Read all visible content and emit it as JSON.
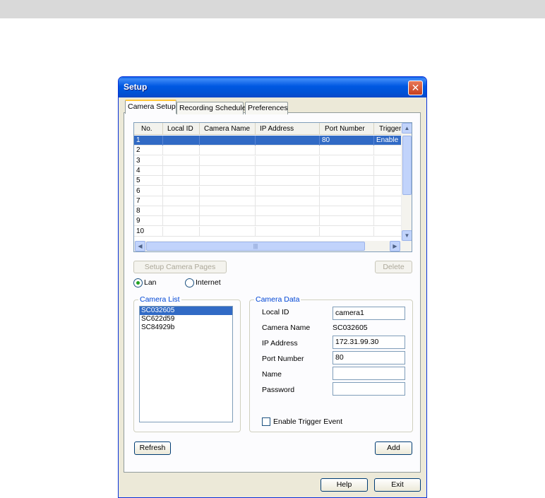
{
  "window": {
    "title": "Setup",
    "close_glyph": "✕"
  },
  "tabs": [
    "Camera Setup",
    "Recording Schedule",
    "Preferences"
  ],
  "grid": {
    "columns": [
      "No.",
      "Local ID",
      "Camera Name",
      "IP Address",
      "Port Number",
      "Trigger"
    ],
    "rows": [
      [
        "1",
        "",
        "",
        "",
        "80",
        "Enable"
      ],
      [
        "2",
        "",
        "",
        "",
        "",
        ""
      ],
      [
        "3",
        "",
        "",
        "",
        "",
        ""
      ],
      [
        "4",
        "",
        "",
        "",
        "",
        ""
      ],
      [
        "5",
        "",
        "",
        "",
        "",
        ""
      ],
      [
        "6",
        "",
        "",
        "",
        "",
        ""
      ],
      [
        "7",
        "",
        "",
        "",
        "",
        ""
      ],
      [
        "8",
        "",
        "",
        "",
        "",
        ""
      ],
      [
        "9",
        "",
        "",
        "",
        "",
        ""
      ],
      [
        "10",
        "",
        "",
        "",
        "",
        ""
      ]
    ],
    "selected_row": 0
  },
  "buttons": {
    "setup_camera_pages": "Setup Camera Pages",
    "delete": "Delete",
    "refresh": "Refresh",
    "add": "Add",
    "help": "Help",
    "exit": "Exit"
  },
  "network": {
    "lan": "Lan",
    "internet": "Internet",
    "selected": "Lan"
  },
  "camera_list": {
    "title": "Camera List",
    "items": [
      "SC032605",
      "SC622d59",
      "SC84929b"
    ],
    "selected": 0
  },
  "camera_data": {
    "title": "Camera Data",
    "local_id_label": "Local ID",
    "local_id_value": "camera1",
    "camera_name_label": "Camera Name",
    "camera_name_value": "SC032605",
    "ip_label": "IP Address",
    "ip_value": "172.31.99.30",
    "port_label": "Port Number",
    "port_value": "80",
    "name_label": "Name",
    "name_value": "",
    "password_label": "Password",
    "password_value": "",
    "trigger_label": "Enable Trigger Event",
    "trigger_checked": false
  }
}
